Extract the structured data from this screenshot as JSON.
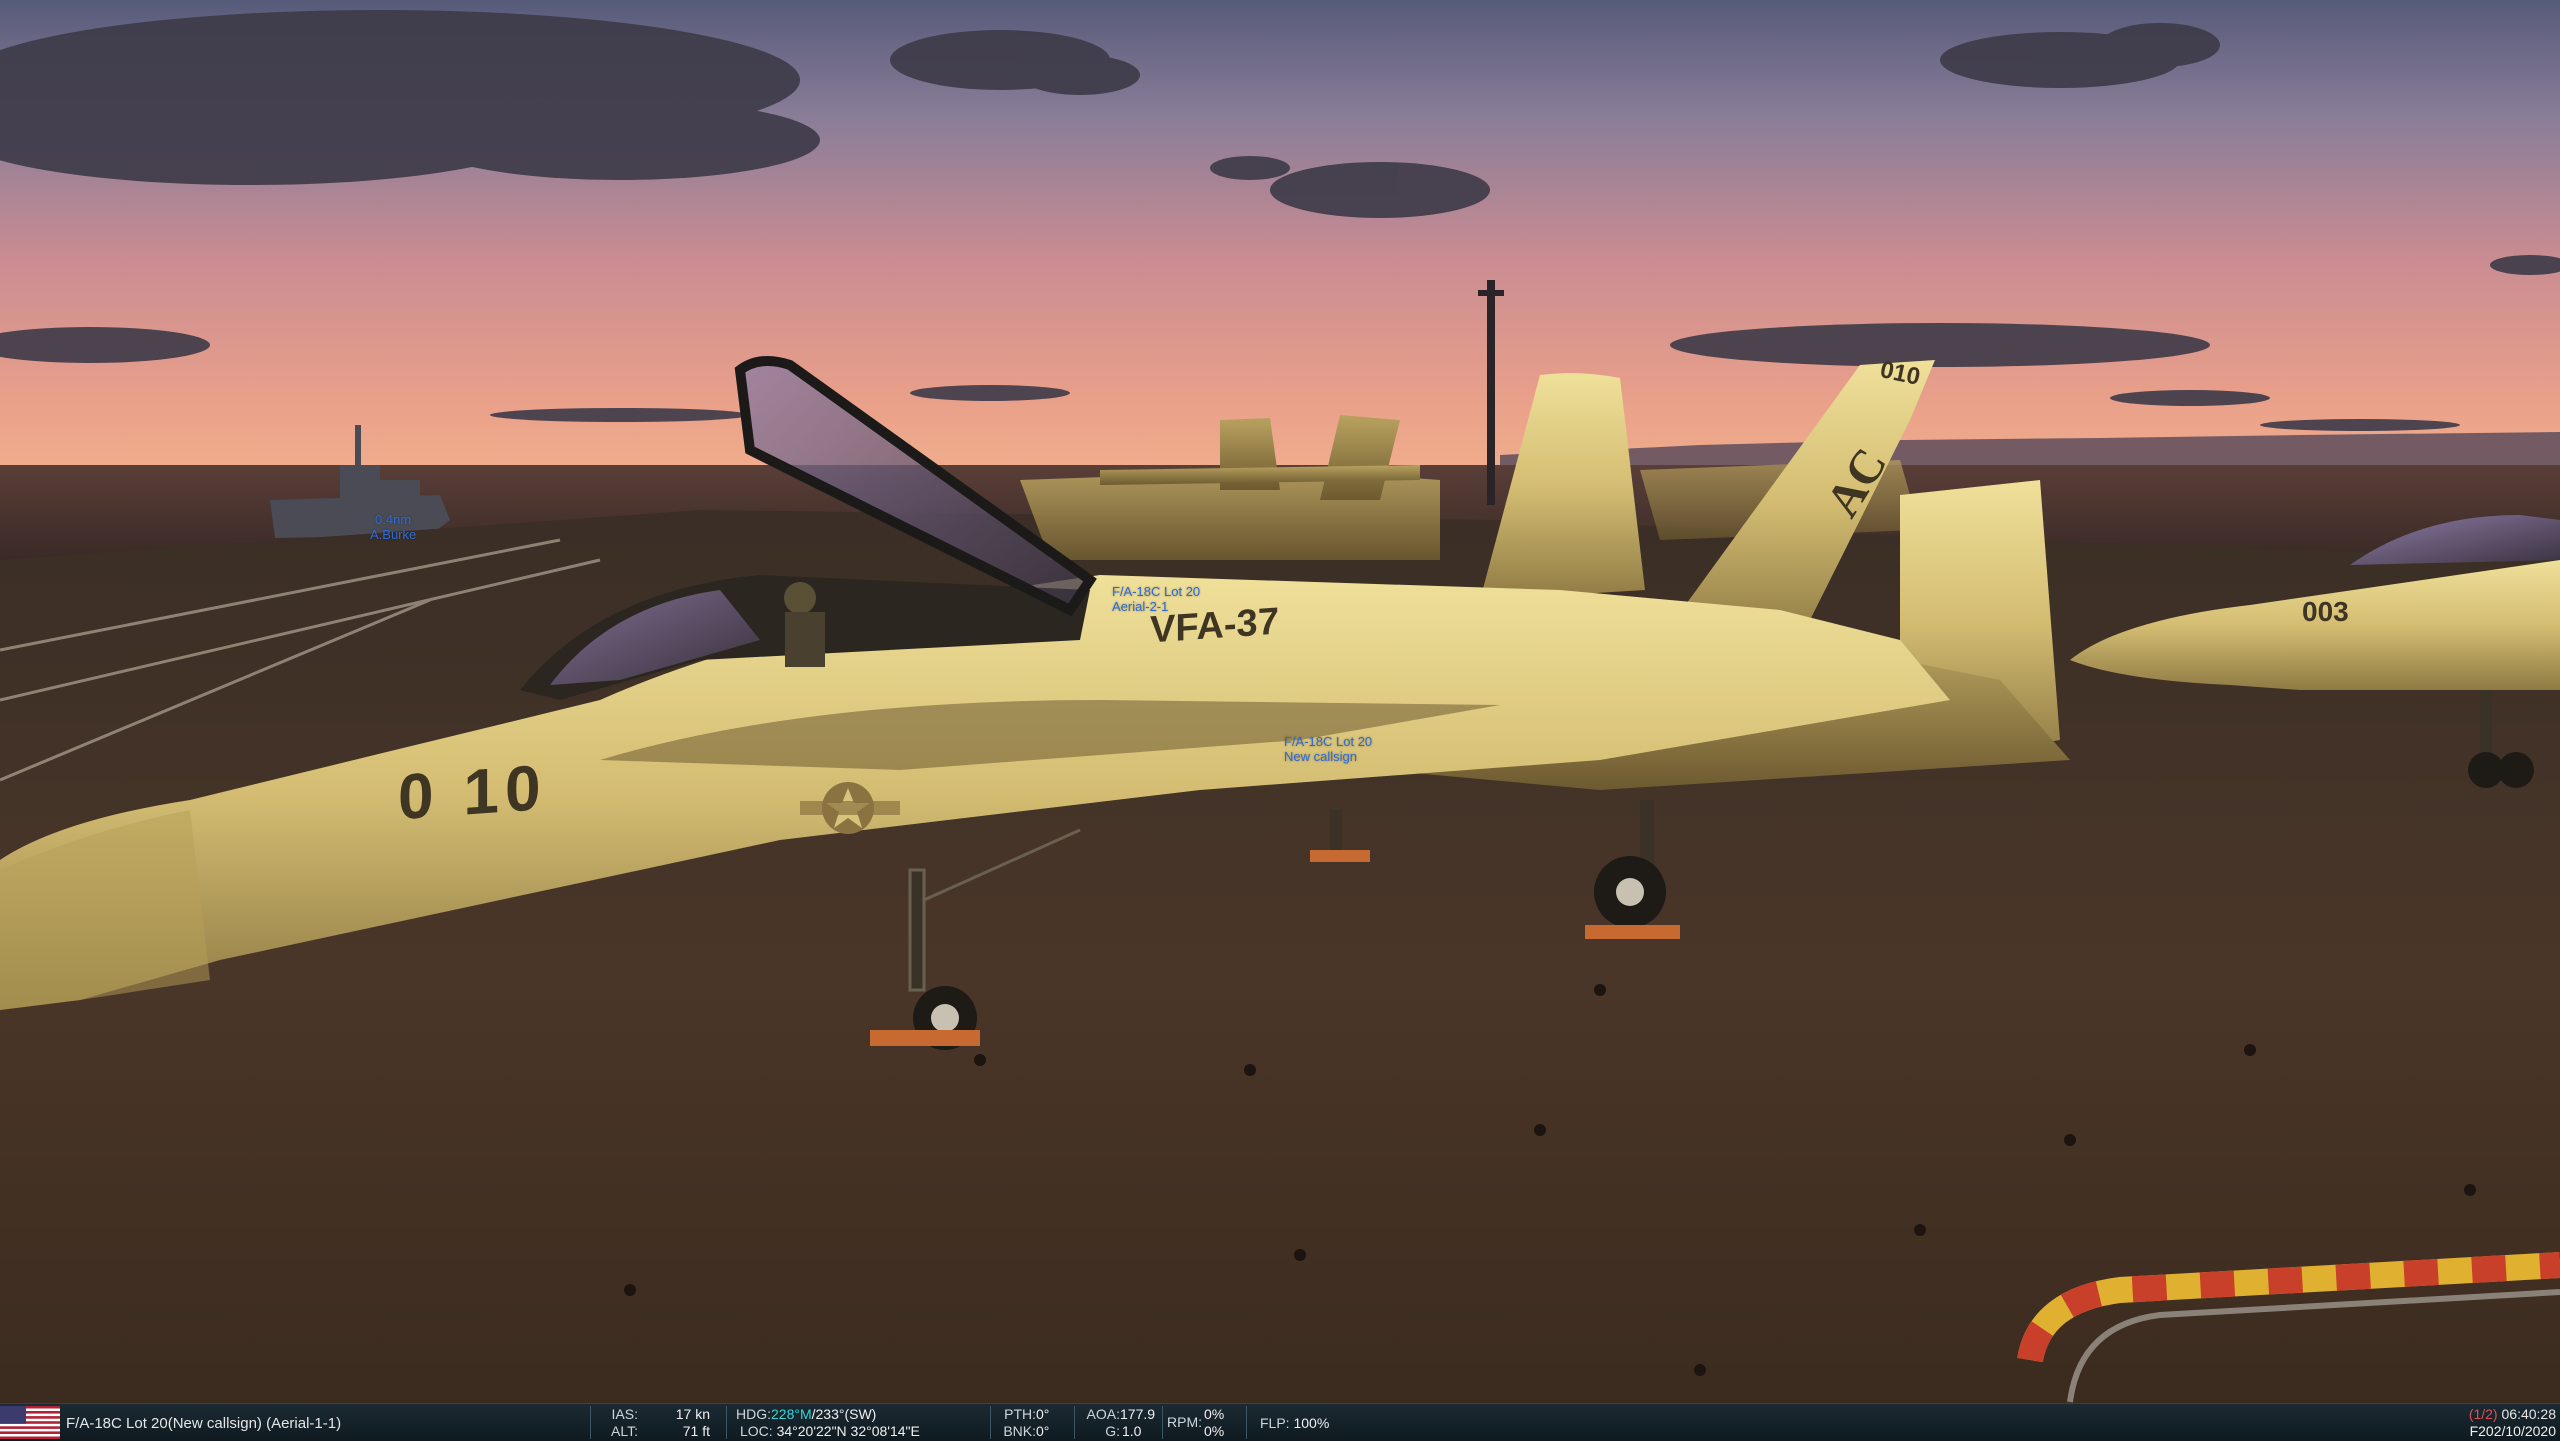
{
  "scene": {
    "ship_label": {
      "range": "0.4nm",
      "name": "A.Burke"
    },
    "jet_label_near": {
      "type": "F/A-18C Lot 20",
      "callsign": "New callsign"
    },
    "jet_label_far": {
      "type": "F/A-18C Lot 20",
      "callsign": "Aerial-2-1"
    },
    "jet_modex_main": "0 10",
    "jet_squadron": "VFA-37",
    "tail_modex": "010",
    "tail_code": "AC",
    "jet_modex_right": "003",
    "colors": {
      "sky_top": "#5b5f7e",
      "sky_horizon": "#e59b8a",
      "sea": "#3a2a26",
      "deck": "#3e2e22",
      "jet_paint": "#d6c27a",
      "label_blue": "#2d6bd8"
    }
  },
  "status_bar": {
    "flag_icon": "usa-flag-icon",
    "unit": "F/A-18C Lot 20(New callsign) (Aerial-1-1)",
    "ias_label": "IAS:",
    "ias_value": "17 kn",
    "alt_label": "ALT:",
    "alt_value": "71 ft",
    "hdg_label": "HDG:",
    "hdg_mag": "228°M",
    "hdg_true": "/233°(SW)",
    "loc_label": "LOC:",
    "loc_value": "34°20'22\"N 32°08'14\"E",
    "pth_label": "PTH:",
    "pth_value": "0°",
    "bnk_label": "BNK:",
    "bnk_value": "0°",
    "aoa_label": "AOA:",
    "aoa_value": "177.9",
    "g_label": "G:",
    "g_value": "1.0",
    "rpm_label": "RPM:",
    "rpm_value_1": "0%",
    "rpm_value_2": "0%",
    "flp_label": "FLP:",
    "flp_value": "100%",
    "page": "(1/2)",
    "time": "06:40:28",
    "date": "F202/10/2020"
  }
}
